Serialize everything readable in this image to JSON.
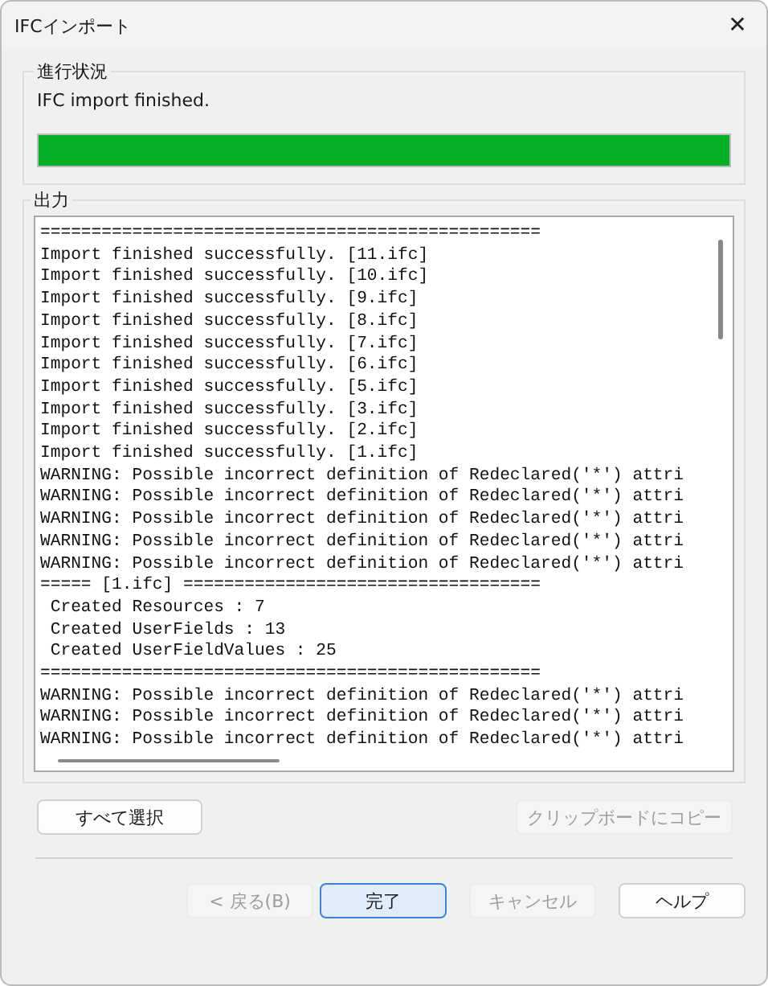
{
  "window": {
    "title": "IFCインポート",
    "close": "✕"
  },
  "progress_group": {
    "label": "進行状況",
    "status": "IFC import finished.",
    "level": 1
  },
  "output_group": {
    "label": "出力",
    "lines": [
      "=================================================",
      "Import finished successfully. [11.ifc]",
      "Import finished successfully. [10.ifc]",
      "Import finished successfully. [9.ifc]",
      "Import finished successfully. [8.ifc]",
      "Import finished successfully. [7.ifc]",
      "Import finished successfully. [6.ifc]",
      "Import finished successfully. [5.ifc]",
      "Import finished successfully. [3.ifc]",
      "Import finished successfully. [2.ifc]",
      "Import finished successfully. [1.ifc]",
      "WARNING: Possible incorrect definition of Redeclared('*') attri",
      "WARNING: Possible incorrect definition of Redeclared('*') attri",
      "WARNING: Possible incorrect definition of Redeclared('*') attri",
      "WARNING: Possible incorrect definition of Redeclared('*') attri",
      "WARNING: Possible incorrect definition of Redeclared('*') attri",
      "===== [1.ifc] ===================================",
      " Created Resources : 7",
      " Created UserFields : 13",
      " Created UserFieldValues : 25",
      "=================================================",
      "WARNING: Possible incorrect definition of Redeclared('*') attri",
      "WARNING: Possible incorrect definition of Redeclared('*') attri",
      "WARNING: Possible incorrect definition of Redeclared('*') attri"
    ]
  },
  "output_buttons": [
    {
      "label": "すべて選択",
      "disabled": false
    },
    {
      "label": "クリップボードにコピー",
      "disabled": true
    }
  ],
  "footer_buttons": [
    {
      "label": "< 戻る(B)",
      "disabled": true,
      "default": false
    },
    {
      "label": "完了",
      "disabled": false,
      "default": true
    },
    {
      "label": "キャンセル",
      "disabled": true,
      "default": false
    },
    {
      "label": "ヘルプ",
      "disabled": false,
      "default": false
    }
  ]
}
